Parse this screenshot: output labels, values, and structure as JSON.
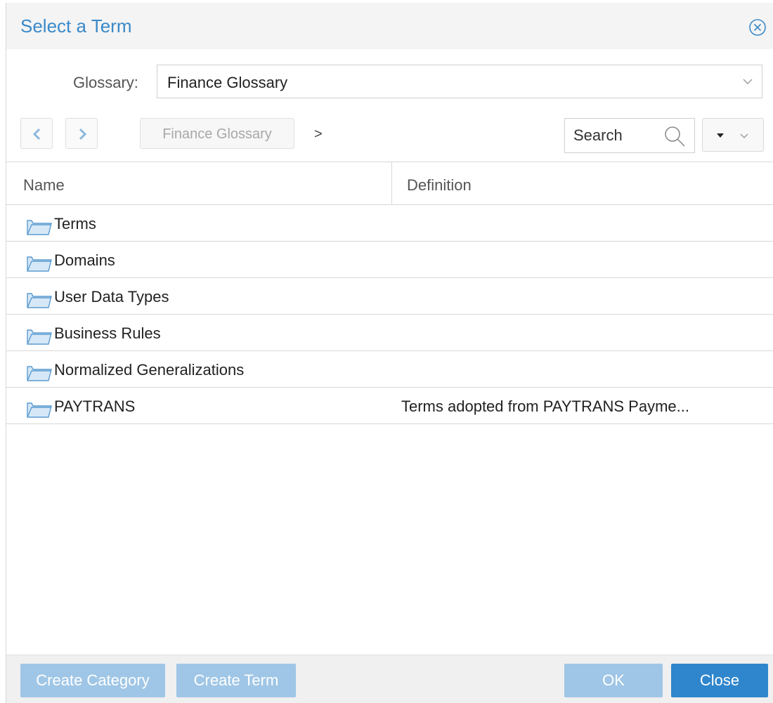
{
  "dialog": {
    "title": "Select a Term"
  },
  "glossary": {
    "label": "Glossary:",
    "selected": "Finance Glossary"
  },
  "toolbar": {
    "breadcrumb": "Finance Glossary",
    "breadcrumb_separator": ">",
    "search_placeholder": "Search"
  },
  "table": {
    "columns": [
      "Name",
      "Definition"
    ],
    "rows": [
      {
        "name": "Terms",
        "definition": ""
      },
      {
        "name": "Domains",
        "definition": ""
      },
      {
        "name": "User Data Types",
        "definition": ""
      },
      {
        "name": "Business Rules",
        "definition": ""
      },
      {
        "name": "Normalized Generalizations",
        "definition": ""
      },
      {
        "name": "PAYTRANS",
        "definition": "Terms adopted from PAYTRANS Payme..."
      }
    ]
  },
  "footer": {
    "create_category": "Create Category",
    "create_term": "Create Term",
    "ok": "OK",
    "close": "Close"
  },
  "colors": {
    "accent": "#3a89c9",
    "primary_button": "#2f86cc",
    "disabled_button": "#9fc6e6",
    "folder_icon": "#7fb3dd"
  },
  "icons": [
    "close-circle-icon",
    "chevron-down-icon",
    "chevron-left-icon",
    "chevron-right-icon",
    "search-icon",
    "folder-icon",
    "caret-down-icon"
  ]
}
